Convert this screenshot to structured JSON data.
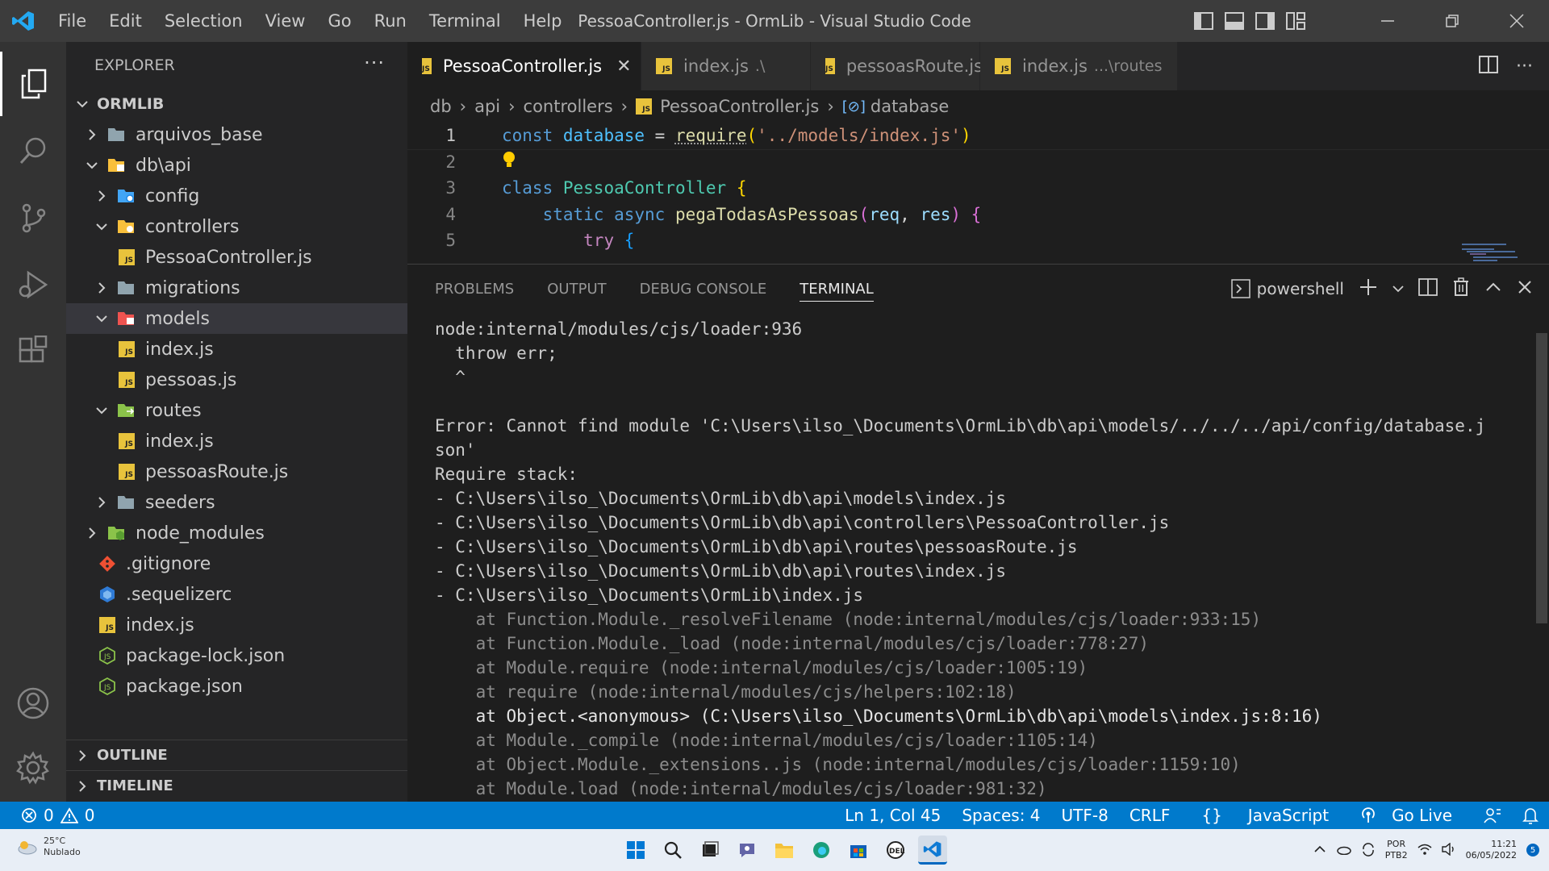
{
  "window": {
    "title": "PessoaController.js - OrmLib - Visual Studio Code"
  },
  "menu": [
    "File",
    "Edit",
    "Selection",
    "View",
    "Go",
    "Run",
    "Terminal",
    "Help"
  ],
  "sidebar": {
    "title": "EXPLORER",
    "more": "···",
    "root": "ORMLIB",
    "items": [
      {
        "label": "arquivos_base"
      },
      {
        "label": "db\\api"
      },
      {
        "label": "config"
      },
      {
        "label": "controllers"
      },
      {
        "label": "PessoaController.js"
      },
      {
        "label": "migrations"
      },
      {
        "label": "models"
      },
      {
        "label": "index.js"
      },
      {
        "label": "pessoas.js"
      },
      {
        "label": "routes"
      },
      {
        "label": "index.js"
      },
      {
        "label": "pessoasRoute.js"
      },
      {
        "label": "seeders"
      },
      {
        "label": "node_modules"
      },
      {
        "label": ".gitignore"
      },
      {
        "label": ".sequelizerc"
      },
      {
        "label": "index.js"
      },
      {
        "label": "package-lock.json"
      },
      {
        "label": "package.json"
      }
    ],
    "outline": "OUTLINE",
    "timeline": "TIMELINE"
  },
  "tabs": [
    {
      "label": "PessoaController.js",
      "suffix": ""
    },
    {
      "label": "index.js",
      "suffix": ".\\"
    },
    {
      "label": "pessoasRoute.js",
      "suffix": ""
    },
    {
      "label": "index.js",
      "suffix": "...\\routes"
    }
  ],
  "breadcrumb": [
    "db",
    "api",
    "controllers",
    "PessoaController.js",
    "database"
  ],
  "code": {
    "line_numbers": [
      "1",
      "2",
      "3",
      "4",
      "5"
    ],
    "l1": {
      "kw": "const",
      "name": "database",
      "eq": " = ",
      "fn": "require",
      "p1": "(",
      "str": "'../models/index.js'",
      "p2": ")"
    },
    "l3": {
      "kw": "class",
      "name": "PessoaController",
      "brace": " {"
    },
    "l4": {
      "kw1": "static",
      "kw2": "async",
      "fn": "pegaTodasAsPessoas",
      "p1": "(",
      "a1": "req",
      "c": ", ",
      "a2": "res",
      "p2": ")",
      "brace": " {"
    },
    "l5": {
      "kw": "try",
      "brace": " {"
    }
  },
  "panel": {
    "tabs": [
      "PROBLEMS",
      "OUTPUT",
      "DEBUG CONSOLE",
      "TERMINAL"
    ],
    "shell": "powershell",
    "lines": [
      "node:internal/modules/cjs/loader:936",
      "  throw err;",
      "  ^",
      "",
      "Error: Cannot find module 'C:\\Users\\ilso_\\Documents\\OrmLib\\db\\api\\models/../../../api/config/database.j",
      "son'",
      "Require stack:",
      "- C:\\Users\\ilso_\\Documents\\OrmLib\\db\\api\\models\\index.js",
      "- C:\\Users\\ilso_\\Documents\\OrmLib\\db\\api\\controllers\\PessoaController.js",
      "- C:\\Users\\ilso_\\Documents\\OrmLib\\db\\api\\routes\\pessoasRoute.js",
      "- C:\\Users\\ilso_\\Documents\\OrmLib\\db\\api\\routes\\index.js",
      "- C:\\Users\\ilso_\\Documents\\OrmLib\\index.js",
      "    at Function.Module._resolveFilename (node:internal/modules/cjs/loader:933:15)",
      "    at Function.Module._load (node:internal/modules/cjs/loader:778:27)",
      "    at Module.require (node:internal/modules/cjs/loader:1005:19)",
      "    at require (node:internal/modules/cjs/helpers:102:18)",
      "    at Object.<anonymous> (C:\\Users\\ilso_\\Documents\\OrmLib\\db\\api\\models\\index.js:8:16)",
      "    at Module._compile (node:internal/modules/cjs/loader:1105:14)",
      "    at Object.Module._extensions..js (node:internal/modules/cjs/loader:1159:10)",
      "    at Module.load (node:internal/modules/cjs/loader:981:32)"
    ]
  },
  "status": {
    "errors": "0",
    "warnings": "0",
    "position": "Ln 1, Col 45",
    "spaces": "Spaces: 4",
    "encoding": "UTF-8",
    "eol": "CRLF",
    "language": "JavaScript",
    "golive": "Go Live"
  },
  "taskbar": {
    "temp": "25°C",
    "weather": "Nublado",
    "lang1": "POR",
    "lang2": "PTB2",
    "time": "11:21",
    "date": "06/05/2022",
    "notif": "5"
  },
  "colors": {
    "accent": "#007acc",
    "keyword": "#569cd6",
    "function": "#dcdcaa",
    "string": "#ce9178",
    "class": "#4ec9b0",
    "param": "#9cdcfe",
    "control": "#c586c0"
  }
}
